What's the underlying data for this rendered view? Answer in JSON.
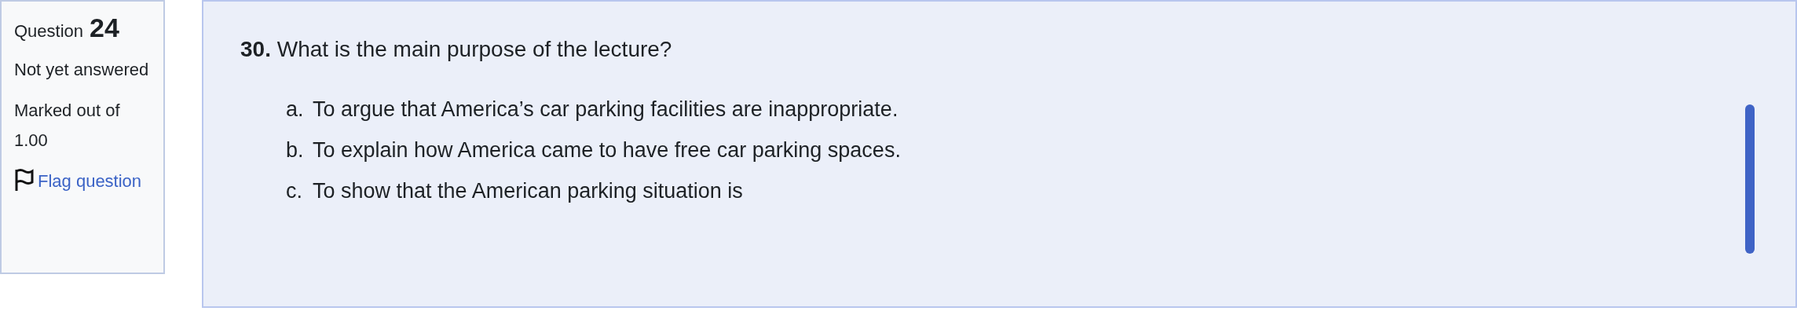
{
  "info": {
    "question_label": "Question",
    "question_number": "24",
    "status": "Not yet answered",
    "marked_out_of": "Marked out of 1.00",
    "flag_link": "Flag question"
  },
  "question": {
    "number": "30.",
    "text": "What is the main purpose of the lecture?",
    "options": [
      {
        "letter": "a.",
        "text": "To argue that America’s car parking facilities are inappropriate."
      },
      {
        "letter": "b.",
        "text": "To explain how America came to have free car parking spaces."
      },
      {
        "letter": "c.",
        "text": "To show that the American parking situation is"
      }
    ]
  }
}
